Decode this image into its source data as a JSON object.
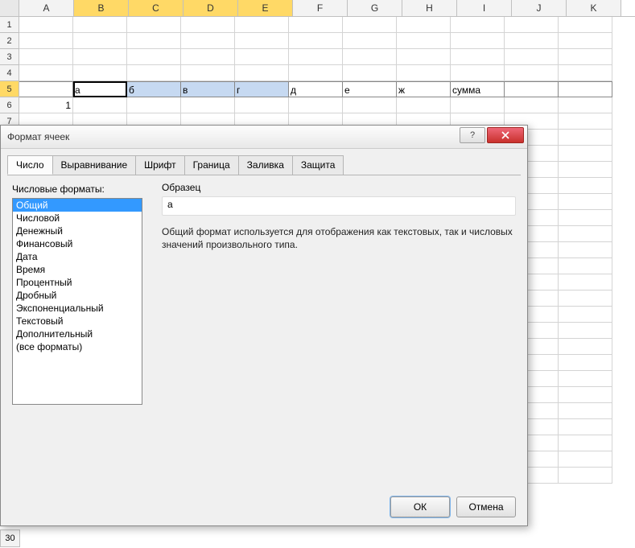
{
  "sheet": {
    "columns": [
      "A",
      "B",
      "C",
      "D",
      "E",
      "F",
      "G",
      "H",
      "I",
      "J",
      "K"
    ],
    "rows": [
      "1",
      "2",
      "3",
      "4",
      "5",
      "6"
    ],
    "rows_end": "30",
    "row5": [
      "а",
      "б",
      "в",
      "г",
      "д",
      "е",
      "ж",
      "сумма"
    ],
    "row6": [
      "1"
    ]
  },
  "dialog": {
    "title": "Формат ячеек",
    "help_icon": "?",
    "tabs": [
      "Число",
      "Выравнивание",
      "Шрифт",
      "Граница",
      "Заливка",
      "Защита"
    ],
    "formats_label": "Числовые форматы:",
    "formats": [
      "Общий",
      "Числовой",
      "Денежный",
      "Финансовый",
      "Дата",
      "Время",
      "Процентный",
      "Дробный",
      "Экспоненциальный",
      "Текстовый",
      "Дополнительный",
      "(все форматы)"
    ],
    "sample_label": "Образец",
    "sample_value": "а",
    "description": "Общий формат используется для отображения как текстовых, так и числовых значений произвольного типа.",
    "ok": "ОК",
    "cancel": "Отмена"
  }
}
